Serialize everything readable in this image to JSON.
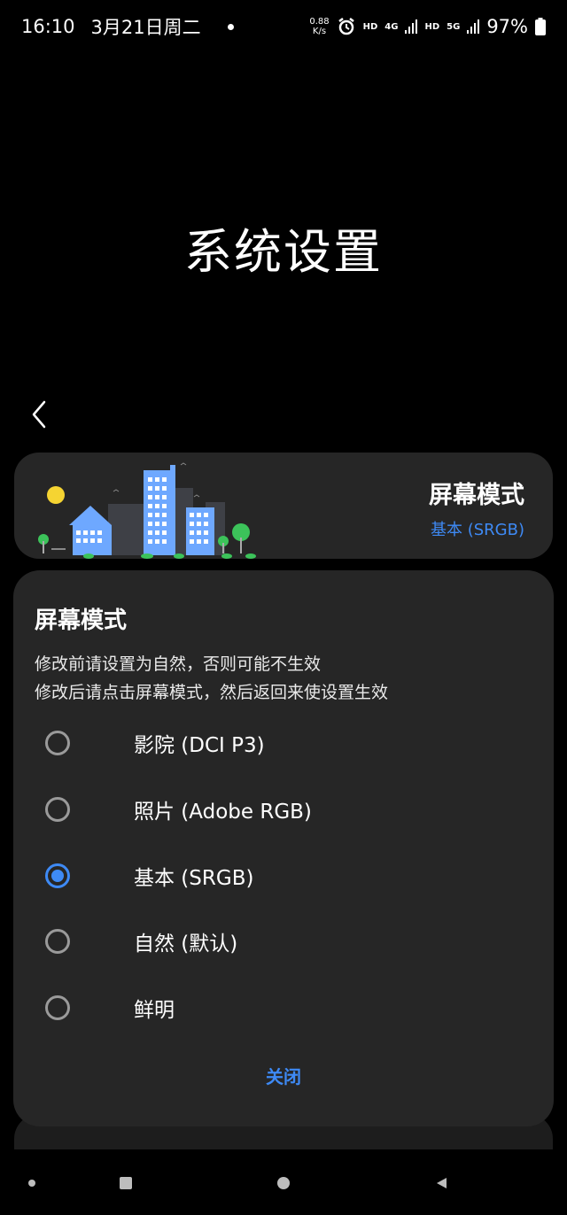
{
  "status_bar": {
    "time": "16:10",
    "date": "3月21日周二",
    "net_speed_value": "0.88",
    "net_speed_unit": "K/s",
    "hd1": "HD",
    "net1": "4G",
    "hd2": "HD",
    "net2": "5G",
    "battery": "97%"
  },
  "page": {
    "title": "系统设置"
  },
  "header_card": {
    "title": "屏幕模式",
    "subtitle": "基本 (SRGB)"
  },
  "dialog": {
    "title": "屏幕模式",
    "desc_line1": "修改前请设置为自然，否则可能不生效",
    "desc_line2": "修改后请点击屏幕模式，然后返回来使设置生效",
    "options": [
      {
        "label": "影院 (DCI P3)",
        "selected": false
      },
      {
        "label": "照片 (Adobe RGB)",
        "selected": false
      },
      {
        "label": "基本 (SRGB)",
        "selected": true
      },
      {
        "label": "自然 (默认)",
        "selected": false
      },
      {
        "label": "鲜明",
        "selected": false
      }
    ],
    "close_label": "关闭"
  },
  "colors": {
    "accent": "#3e8af5",
    "card_bg": "#262626",
    "background": "#000000"
  }
}
